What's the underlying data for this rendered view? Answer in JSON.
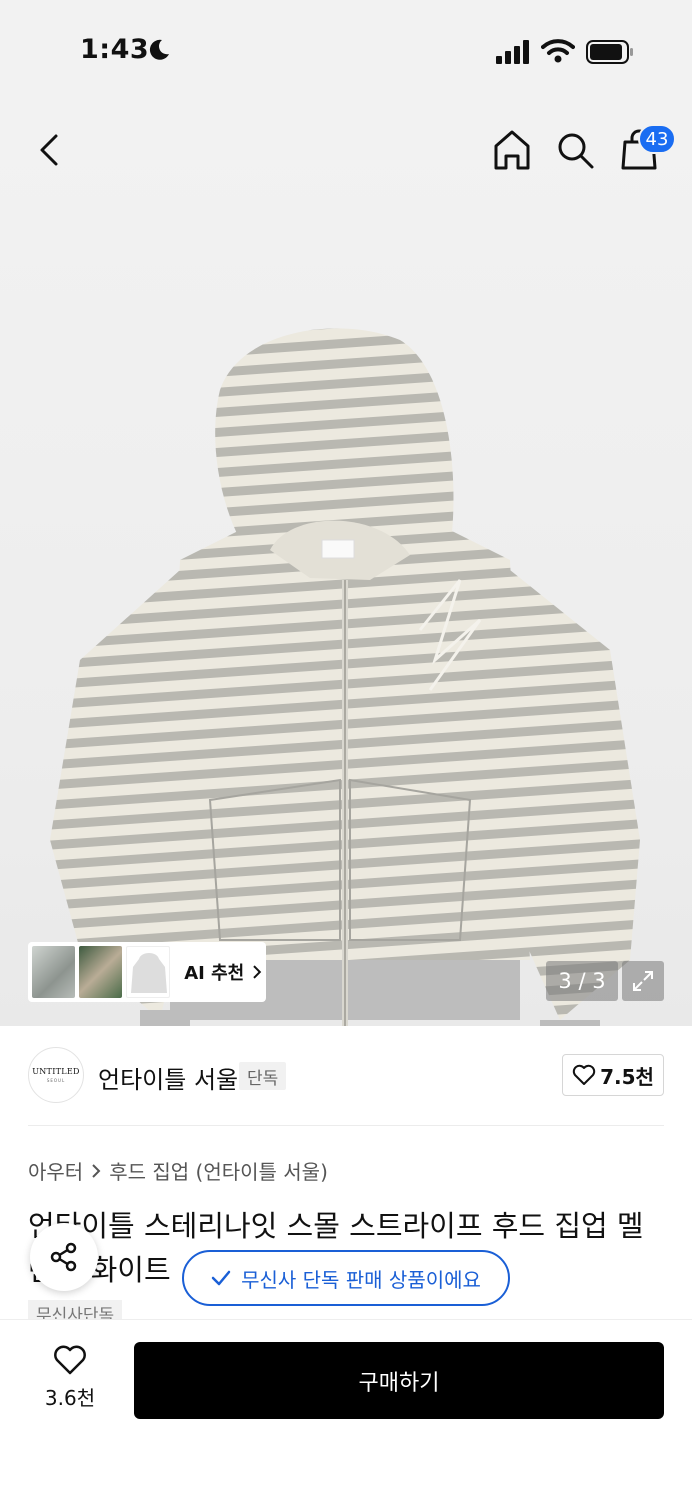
{
  "status": {
    "time": "1:43"
  },
  "header": {
    "cart_count": "43"
  },
  "gallery": {
    "ai_label": "AI 추천",
    "page_indicator": "3 / 3"
  },
  "brand": {
    "logo_text": "UNTITLED",
    "logo_sub": "SEOUL",
    "name": "언타이틀 서울",
    "tag": "단독",
    "likes": "7.5천"
  },
  "breadcrumb": {
    "category": "아우터",
    "subcategory": "후드 집업 (언타이틀 서울)"
  },
  "product": {
    "title": "언타이틀 스테리나잇 스몰 스트라이프 후드 집업 멜란지 화이트",
    "exclusive_badge": "무신사 단독 판매 상품이에요",
    "tag": "무신사단독"
  },
  "bottom": {
    "likes": "3.6천",
    "buy_label": "구매하기"
  },
  "colors": {
    "accent": "#1a5fd6",
    "badge": "#1a6df2",
    "buy_button": "#000000"
  }
}
